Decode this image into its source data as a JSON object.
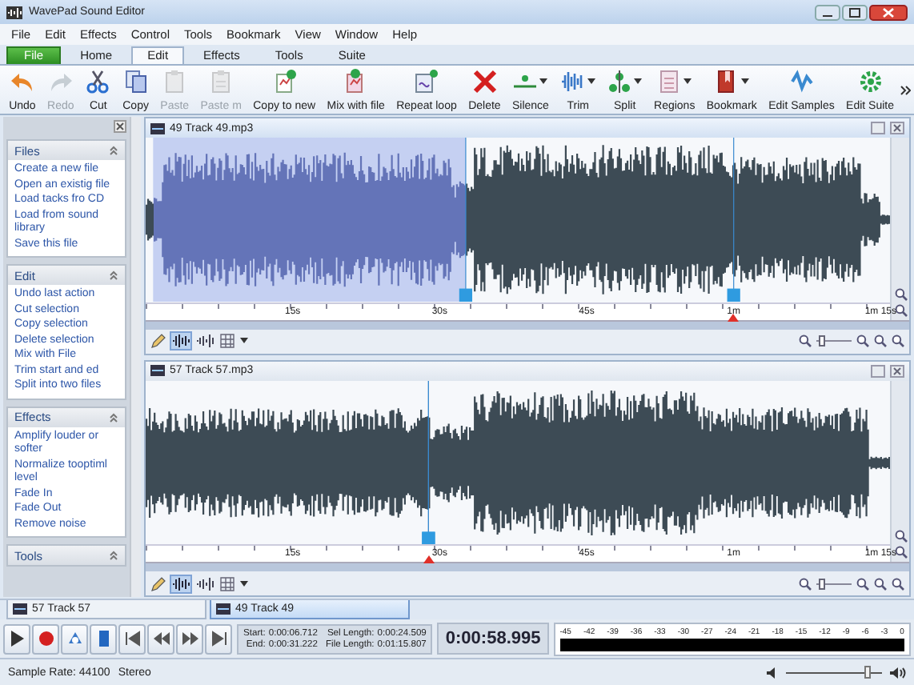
{
  "window": {
    "title": "WavePad Sound Editor"
  },
  "menu": [
    "File",
    "Edit",
    "Effects",
    "Control",
    "Tools",
    "Bookmark",
    "View",
    "Window",
    "Help"
  ],
  "ribbon_tabs": [
    {
      "label": "File",
      "kind": "app",
      "selected": false
    },
    {
      "label": "Home",
      "kind": "tab",
      "selected": false
    },
    {
      "label": "Edit",
      "kind": "tab",
      "selected": true
    },
    {
      "label": "Effects",
      "kind": "tab",
      "selected": false
    },
    {
      "label": "Tools",
      "kind": "tab",
      "selected": false
    },
    {
      "label": "Suite",
      "kind": "tab",
      "selected": false
    }
  ],
  "toolbar": [
    {
      "label": "Undo",
      "disabled": false,
      "dropdown": false
    },
    {
      "label": "Redo",
      "disabled": true,
      "dropdown": false
    },
    {
      "label": "Cut",
      "disabled": false,
      "dropdown": false
    },
    {
      "label": "Copy",
      "disabled": false,
      "dropdown": false
    },
    {
      "label": "Paste",
      "disabled": true,
      "dropdown": false
    },
    {
      "label": "Paste m",
      "disabled": true,
      "dropdown": false
    },
    {
      "label": "Copy to new",
      "disabled": false,
      "dropdown": false
    },
    {
      "label": "Mix with file",
      "disabled": false,
      "dropdown": false
    },
    {
      "label": "Repeat loop",
      "disabled": false,
      "dropdown": false
    },
    {
      "label": "Delete",
      "disabled": false,
      "dropdown": false
    },
    {
      "label": "Silence",
      "disabled": false,
      "dropdown": true
    },
    {
      "label": "Trim",
      "disabled": false,
      "dropdown": true
    },
    {
      "label": "Split",
      "disabled": false,
      "dropdown": true
    },
    {
      "label": "Regions",
      "disabled": false,
      "dropdown": true
    },
    {
      "label": "Bookmark",
      "disabled": false,
      "dropdown": true
    },
    {
      "label": "Edit Samples",
      "disabled": false,
      "dropdown": false
    },
    {
      "label": "Edit Suite",
      "disabled": false,
      "dropdown": false
    }
  ],
  "sidebar": {
    "panels": [
      {
        "title": "Files",
        "items": [
          "Create a new file",
          "Open an existig file",
          "Load tacks fro CD",
          "Load from sound library",
          "Save this file"
        ]
      },
      {
        "title": "Edit",
        "items": [
          "Undo last action",
          "Cut selection",
          "Copy selection",
          "Delete selection",
          "Mix with File",
          "Trim start and ed",
          "Split into two files"
        ]
      },
      {
        "title": "Effects",
        "items": [
          "Amplify louder or softer",
          "Normalize tooptiml level",
          "Fade In",
          "Fade Out",
          "Remove noise"
        ]
      },
      {
        "title": "Tools"
      }
    ]
  },
  "tracks": [
    {
      "title": "49 Track 49.mp3",
      "selected": true,
      "ruler": [
        "15s",
        "30s",
        "45s",
        "1m",
        "1m 15s"
      ]
    },
    {
      "title": "57 Track 57.mp3",
      "selected": false,
      "ruler": [
        "15s",
        "30s",
        "45s",
        "1m",
        "1m 15s"
      ]
    }
  ],
  "file_tabs": [
    {
      "label": "57 Track 57",
      "selected": false
    },
    {
      "label": "49 Track 49",
      "selected": true
    }
  ],
  "selection_info": [
    {
      "label": "Start:",
      "value": "0:00:06.712"
    },
    {
      "label": "End:",
      "value": "0:00:31.222"
    },
    {
      "label": "Sel Length:",
      "value": "0:00:24.509"
    },
    {
      "label": "File Length:",
      "value": "0:01:15.807"
    }
  ],
  "position": "0:00:58.995",
  "meter": {
    "scale": [
      "-45",
      "-42",
      "-39",
      "-36",
      "-33",
      "-30",
      "-27",
      "-24",
      "-21",
      "-18",
      "-15",
      "-12",
      "-9",
      "-6",
      "-3",
      "0"
    ]
  },
  "status_bar": {
    "sample_rate": "Sample Rate: 44100",
    "channels": "Stereo",
    "volume": {
      "level": 0.85
    }
  }
}
